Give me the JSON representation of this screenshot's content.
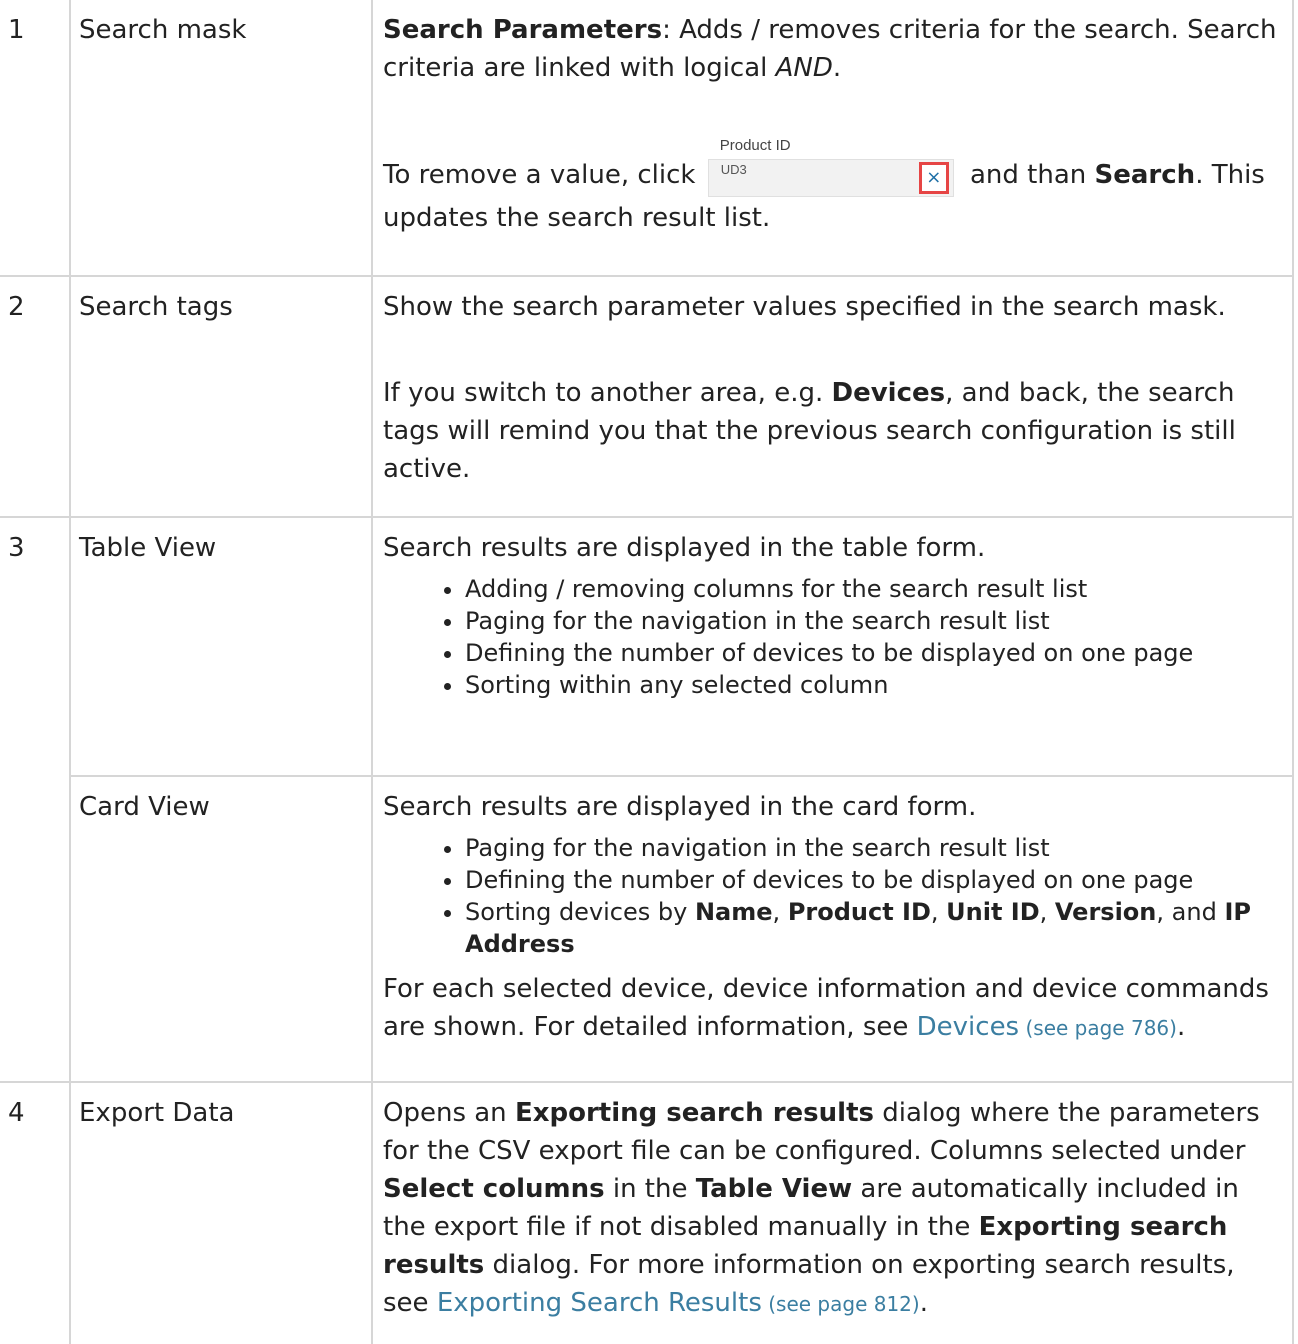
{
  "rows": [
    {
      "num": "1",
      "name": "Search mask",
      "desc": {
        "p1_b": "Search Parameters",
        "p1_t1": ": Adds / removes criteria for the search. Search criteria are linked with logical ",
        "p1_i": "AND",
        "p1_t2": ".",
        "p2_t1": "To remove a value, click ",
        "widget_label": "Product ID",
        "widget_value": "UD3",
        "widget_clear": "×",
        "p2_t2": " and than ",
        "p2_b": "Search",
        "p2_t3": ". This updates the search result list."
      }
    },
    {
      "num": "2",
      "name": "Search tags",
      "desc": {
        "p1": "Show the search parameter values specified in the search mask.",
        "p2_t1": "If you switch to another area, e.g. ",
        "p2_b": "Devices",
        "p2_t2": ", and back, the search tags will remind you that the previous search configuration is still active."
      }
    },
    {
      "num": "3",
      "name": "Table View",
      "desc": {
        "p1": "Search results are displayed in the table form.",
        "bullets": [
          "Adding / removing columns for the search result list",
          "Paging for the navigation in the search result list",
          "Defining the number of devices to be displayed on one page",
          "Sorting within any selected column"
        ]
      }
    },
    {
      "num": "",
      "name": "Card View",
      "desc": {
        "p1": "Search results are displayed in the card form.",
        "bullet1": "Paging for the navigation in the search result list",
        "bullet2": "Defining the number of devices to be displayed on one page",
        "bullet3_t1": "Sorting devices by ",
        "bullet3_b1": "Name",
        "bullet3_s1": ", ",
        "bullet3_b2": "Product ID",
        "bullet3_s2": ", ",
        "bullet3_b3": "Unit ID",
        "bullet3_s3": ", ",
        "bullet3_b4": "Version",
        "bullet3_s4": ", and ",
        "bullet3_b5": "IP Address",
        "p2_t1": "For each selected device, device information and device commands are shown. For detailed information, see ",
        "p2_link": "Devices",
        "p2_ref": " (see page 786)",
        "p2_t2": "."
      }
    },
    {
      "num": "4",
      "name": "Export Data",
      "desc": {
        "t1": "Opens an ",
        "b1": "Exporting search results",
        "t2": " dialog where the parameters for the CSV export file can be configured. Columns selected under ",
        "b2": "Select columns",
        "t3": " in the ",
        "b3": "Table View",
        "t4": " are automatically included in the export file if not disabled manually in the ",
        "b4": "Exporting search results",
        "t5": " dialog. For more information on exporting search results, see ",
        "link": "Exporting Search Results",
        "ref": " (see page 812)",
        "t6": "."
      }
    }
  ]
}
